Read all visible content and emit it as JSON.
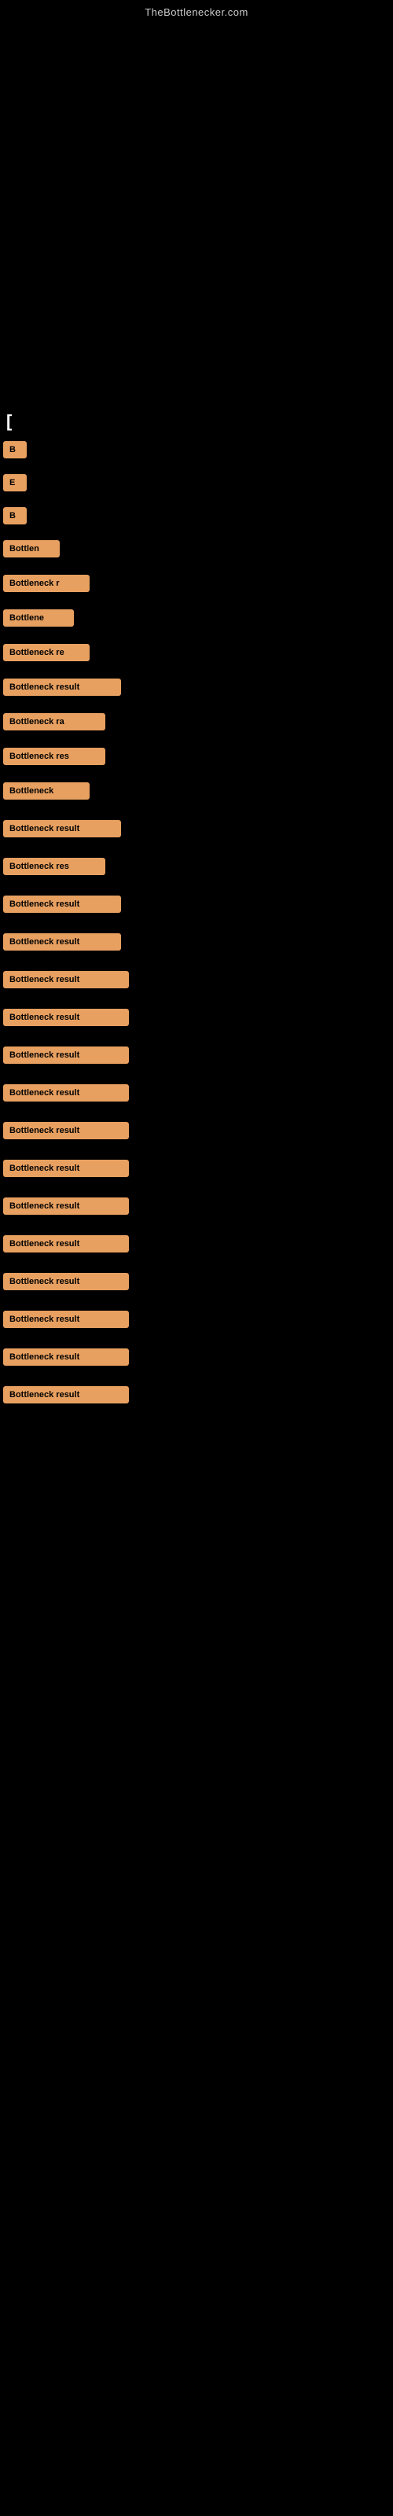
{
  "site": {
    "title": "TheBottlenecker.com"
  },
  "header": {
    "bracket": "["
  },
  "results": [
    {
      "id": 1,
      "label": "B",
      "width_class": "w-30"
    },
    {
      "id": 2,
      "label": "E",
      "width_class": "w-30"
    },
    {
      "id": 3,
      "label": "B",
      "width_class": "w-30"
    },
    {
      "id": 4,
      "label": "Bottlen",
      "width_class": "w-70"
    },
    {
      "id": 5,
      "label": "Bottleneck r",
      "width_class": "w-110"
    },
    {
      "id": 6,
      "label": "Bottlene",
      "width_class": "w-90"
    },
    {
      "id": 7,
      "label": "Bottleneck re",
      "width_class": "w-110"
    },
    {
      "id": 8,
      "label": "Bottleneck result",
      "width_class": "w-150"
    },
    {
      "id": 9,
      "label": "Bottleneck ra",
      "width_class": "w-130"
    },
    {
      "id": 10,
      "label": "Bottleneck res",
      "width_class": "w-130"
    },
    {
      "id": 11,
      "label": "Bottleneck",
      "width_class": "w-110"
    },
    {
      "id": 12,
      "label": "Bottleneck result",
      "width_class": "w-150"
    },
    {
      "id": 13,
      "label": "Bottleneck res",
      "width_class": "w-130"
    },
    {
      "id": 14,
      "label": "Bottleneck result",
      "width_class": "w-150"
    },
    {
      "id": 15,
      "label": "Bottleneck result",
      "width_class": "w-150"
    },
    {
      "id": 16,
      "label": "Bottleneck result",
      "width_class": "w-160"
    },
    {
      "id": 17,
      "label": "Bottleneck result",
      "width_class": "w-160"
    },
    {
      "id": 18,
      "label": "Bottleneck result",
      "width_class": "w-160"
    },
    {
      "id": 19,
      "label": "Bottleneck result",
      "width_class": "w-160"
    },
    {
      "id": 20,
      "label": "Bottleneck result",
      "width_class": "w-160"
    },
    {
      "id": 21,
      "label": "Bottleneck result",
      "width_class": "w-160"
    },
    {
      "id": 22,
      "label": "Bottleneck result",
      "width_class": "w-160"
    },
    {
      "id": 23,
      "label": "Bottleneck result",
      "width_class": "w-160"
    },
    {
      "id": 24,
      "label": "Bottleneck result",
      "width_class": "w-160"
    },
    {
      "id": 25,
      "label": "Bottleneck result",
      "width_class": "w-160"
    },
    {
      "id": 26,
      "label": "Bottleneck result",
      "width_class": "w-160"
    },
    {
      "id": 27,
      "label": "Bottleneck result",
      "width_class": "w-160"
    }
  ],
  "colors": {
    "badge_bg": "#e8a060",
    "badge_text": "#000000",
    "background": "#000000",
    "site_title": "#cccccc"
  }
}
